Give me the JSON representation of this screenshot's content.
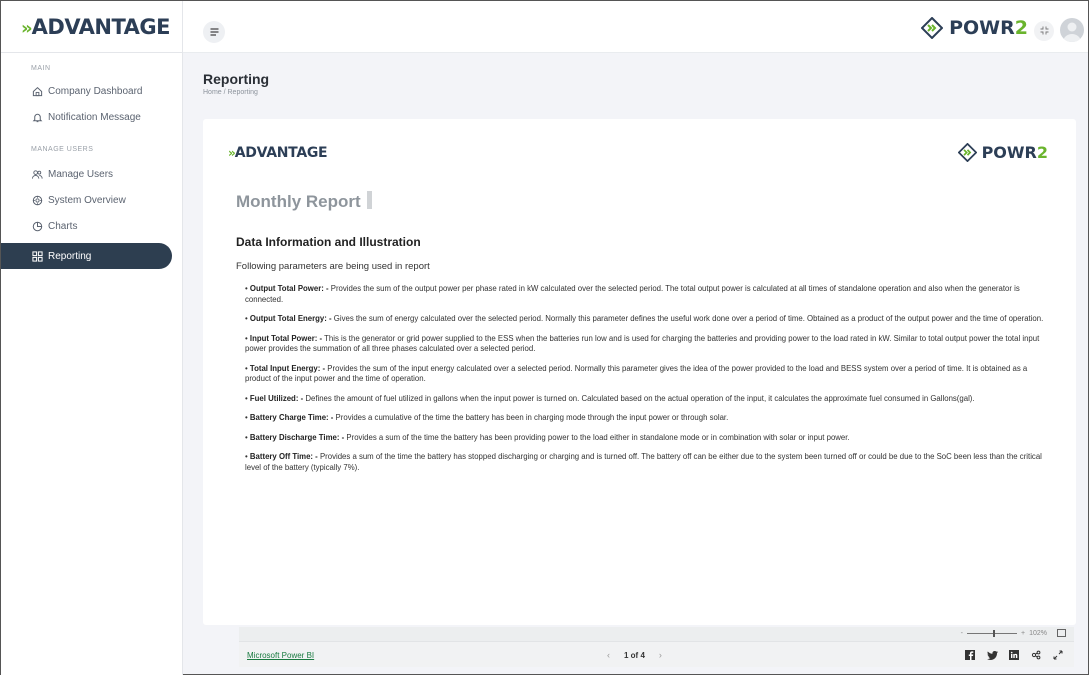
{
  "app": {
    "logo_chev": "»",
    "logo_text": "ADVANTAGE",
    "brand_right_main": "POWR",
    "brand_right_accent": "2"
  },
  "sidebar": {
    "section_main": "MAIN",
    "section_manage": "MANAGE USERS",
    "items": [
      {
        "label": "Company Dashboard",
        "icon": "home-icon"
      },
      {
        "label": "Notification Message",
        "icon": "bell-icon"
      },
      {
        "label": "Manage Users",
        "icon": "users-icon"
      },
      {
        "label": "System Overview",
        "icon": "gear-icon"
      },
      {
        "label": "Charts",
        "icon": "pie-chart-icon"
      },
      {
        "label": "Reporting",
        "icon": "grid-icon",
        "active": true
      }
    ]
  },
  "header": {
    "page_title": "Reporting",
    "breadcrumb": "Home  /  Reporting"
  },
  "report": {
    "logo_chev": "»",
    "logo_text": "ADVANTAGE",
    "brand_main": "POWR",
    "brand_accent": "2",
    "title": "Monthly Report",
    "section_heading": "Data Information and Illustration",
    "intro": "Following parameters are being used in report",
    "params": [
      {
        "name": "Output Total Power: -",
        "text": " Provides the sum of the output power per phase rated in kW calculated over the selected period. The total output power is calculated at all times of standalone operation and also when the generator is connected."
      },
      {
        "name": "Output Total Energy: -",
        "text": " Gives the sum of energy calculated over the selected period. Normally this parameter defines the useful work done over a period of time. Obtained as a product of the output power and the time of operation."
      },
      {
        "name": "Input Total Power: -",
        "text": " This is the generator or grid power supplied to the ESS when the batteries run low and is used for charging the batteries and providing power to the load rated in kW. Similar to total output power the total input power provides the summation of all three phases calculated over a selected period."
      },
      {
        "name": "Total Input Energy: -",
        "text": " Provides the sum of the input energy calculated over a selected period. Normally this parameter gives the idea of the power provided to the load and BESS system over a period of time. It is obtained as a product of the input power and the time of operation."
      },
      {
        "name": "Fuel Utilized: -",
        "text": " Defines the amount of fuel utilized in gallons when the input power is turned on. Calculated based on the actual operation of the input, it calculates the approximate fuel consumed in Gallons(gal)."
      },
      {
        "name": "Battery Charge Time: -",
        "text": " Provides a cumulative of the time the battery has been in charging mode through the input power or through solar."
      },
      {
        "name": "Battery Discharge Time: -",
        "text": " Provides a sum of the time the battery has been providing power to the load either in standalone mode or in combination with solar or input power."
      },
      {
        "name": "Battery Off Time: -",
        "text": " Provides a sum of the time the battery has stopped discharging or charging and is turned off. The battery off can be either due to the system been turned off or could be due to the SoC been less than the critical level of the battery (typically 7%)."
      }
    ]
  },
  "powerbi": {
    "link": "Microsoft Power BI",
    "page_indicator": "1 of 4",
    "prev": "‹",
    "next": "›",
    "zoom_minus": "-",
    "zoom_plus": "+",
    "zoom_level": "102%"
  },
  "colors": {
    "brand_dark": "#2c3e56",
    "brand_green": "#6ab42d",
    "active_nav": "#2d3e50"
  }
}
